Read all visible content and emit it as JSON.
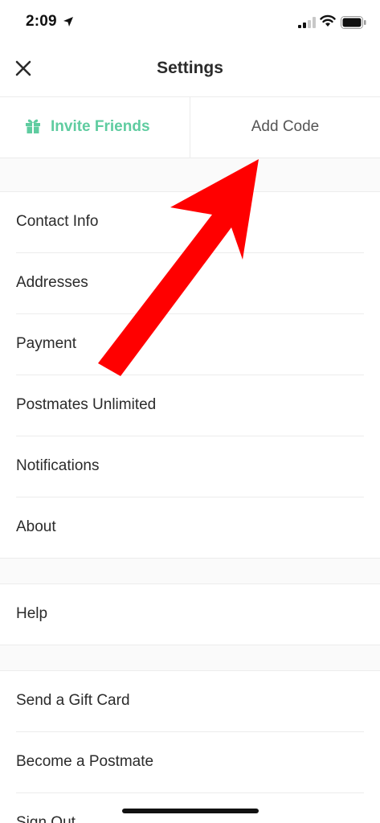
{
  "status_bar": {
    "time": "2:09"
  },
  "nav": {
    "title": "Settings"
  },
  "promo": {
    "invite_label": "Invite Friends",
    "add_code_label": "Add Code"
  },
  "menu_group_1": [
    {
      "label": "Contact Info"
    },
    {
      "label": "Addresses"
    },
    {
      "label": "Payment"
    },
    {
      "label": "Postmates Unlimited"
    },
    {
      "label": "Notifications"
    },
    {
      "label": "About"
    }
  ],
  "menu_group_2": [
    {
      "label": "Help"
    }
  ],
  "menu_group_3": [
    {
      "label": "Send a Gift Card"
    },
    {
      "label": "Become a Postmate"
    },
    {
      "label": "Sign Out"
    }
  ],
  "colors": {
    "accent_green": "#5fcca0",
    "annotation_arrow": "#ff0000"
  },
  "icons": [
    "location-arrow-icon",
    "signal-icon",
    "wifi-icon",
    "battery-icon",
    "close-icon",
    "gift-icon"
  ]
}
